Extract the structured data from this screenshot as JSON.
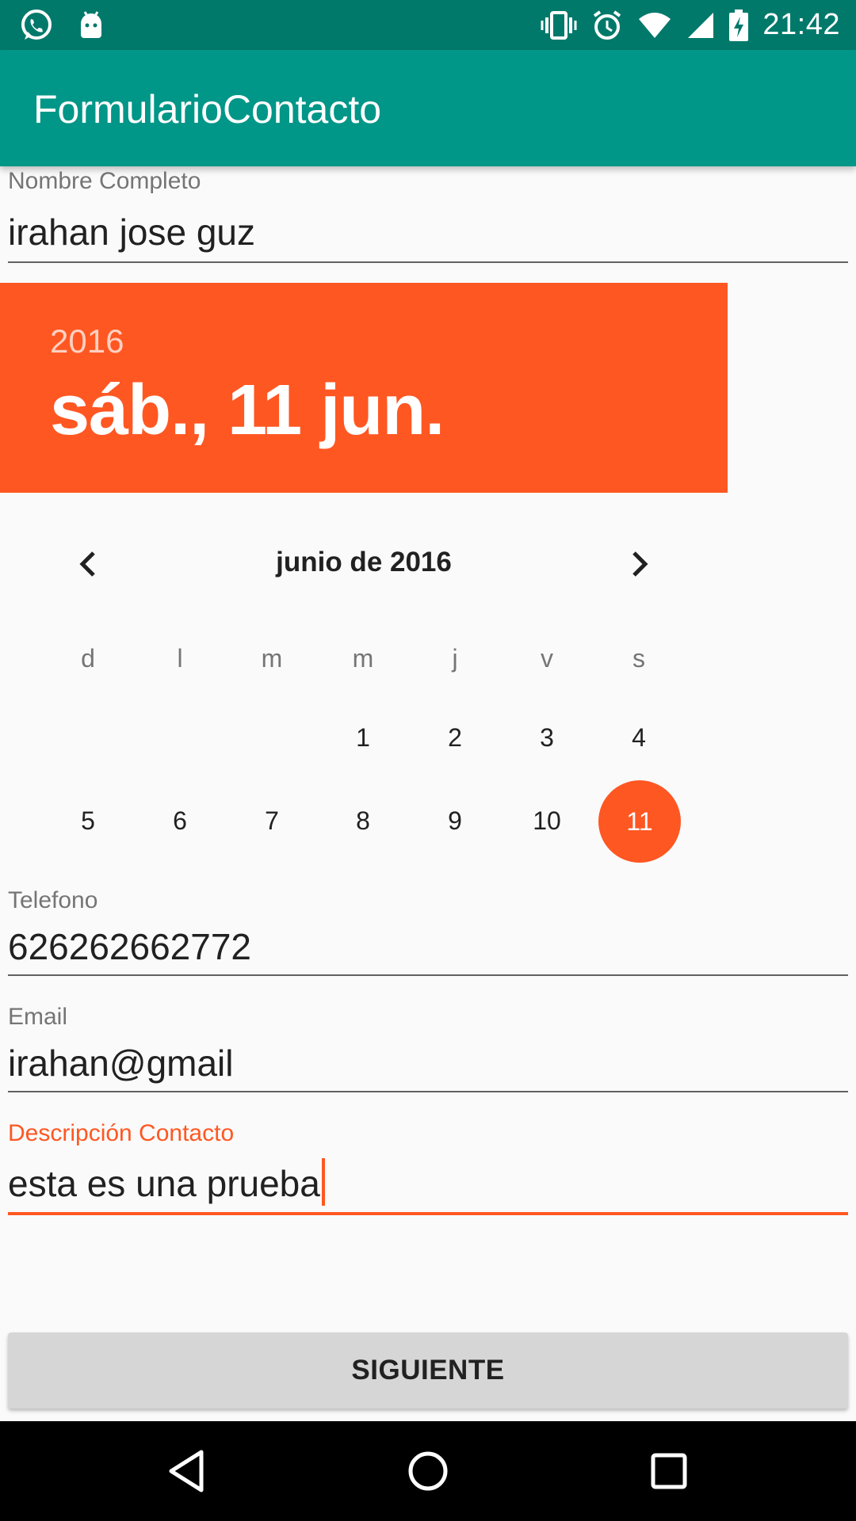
{
  "status_bar": {
    "time": "21:42",
    "icons_left": [
      "whatsapp-icon",
      "android-icon"
    ],
    "icons_right": [
      "vibrate-icon",
      "alarm-icon",
      "wifi-icon",
      "signal-icon",
      "battery-charging-icon"
    ]
  },
  "app_bar": {
    "title": "FormularioContacto"
  },
  "fields": {
    "name": {
      "label": "Nombre Completo",
      "value": "irahan jose guz"
    },
    "phone": {
      "label": "Telefono",
      "value": "626262662772"
    },
    "email": {
      "label": "Email",
      "value": "irahan@gmail"
    },
    "description": {
      "label": "Descripción Contacto",
      "value": "esta es una prueba"
    }
  },
  "date_picker": {
    "year": "2016",
    "selected_date": "sáb., 11 jun.",
    "month_label": "junio de 2016",
    "weekday_headers": [
      "d",
      "l",
      "m",
      "m",
      "j",
      "v",
      "s"
    ],
    "week1": [
      "",
      "",
      "",
      "1",
      "2",
      "3",
      "4"
    ],
    "week2": [
      "5",
      "6",
      "7",
      "8",
      "9",
      "10",
      "11"
    ],
    "selected_day": "11",
    "accent_color": "#ff5722"
  },
  "button": {
    "label": "SIGUIENTE"
  },
  "colors": {
    "app_bar": "#009688",
    "status_bar": "#00796b",
    "accent": "#ff5722"
  }
}
